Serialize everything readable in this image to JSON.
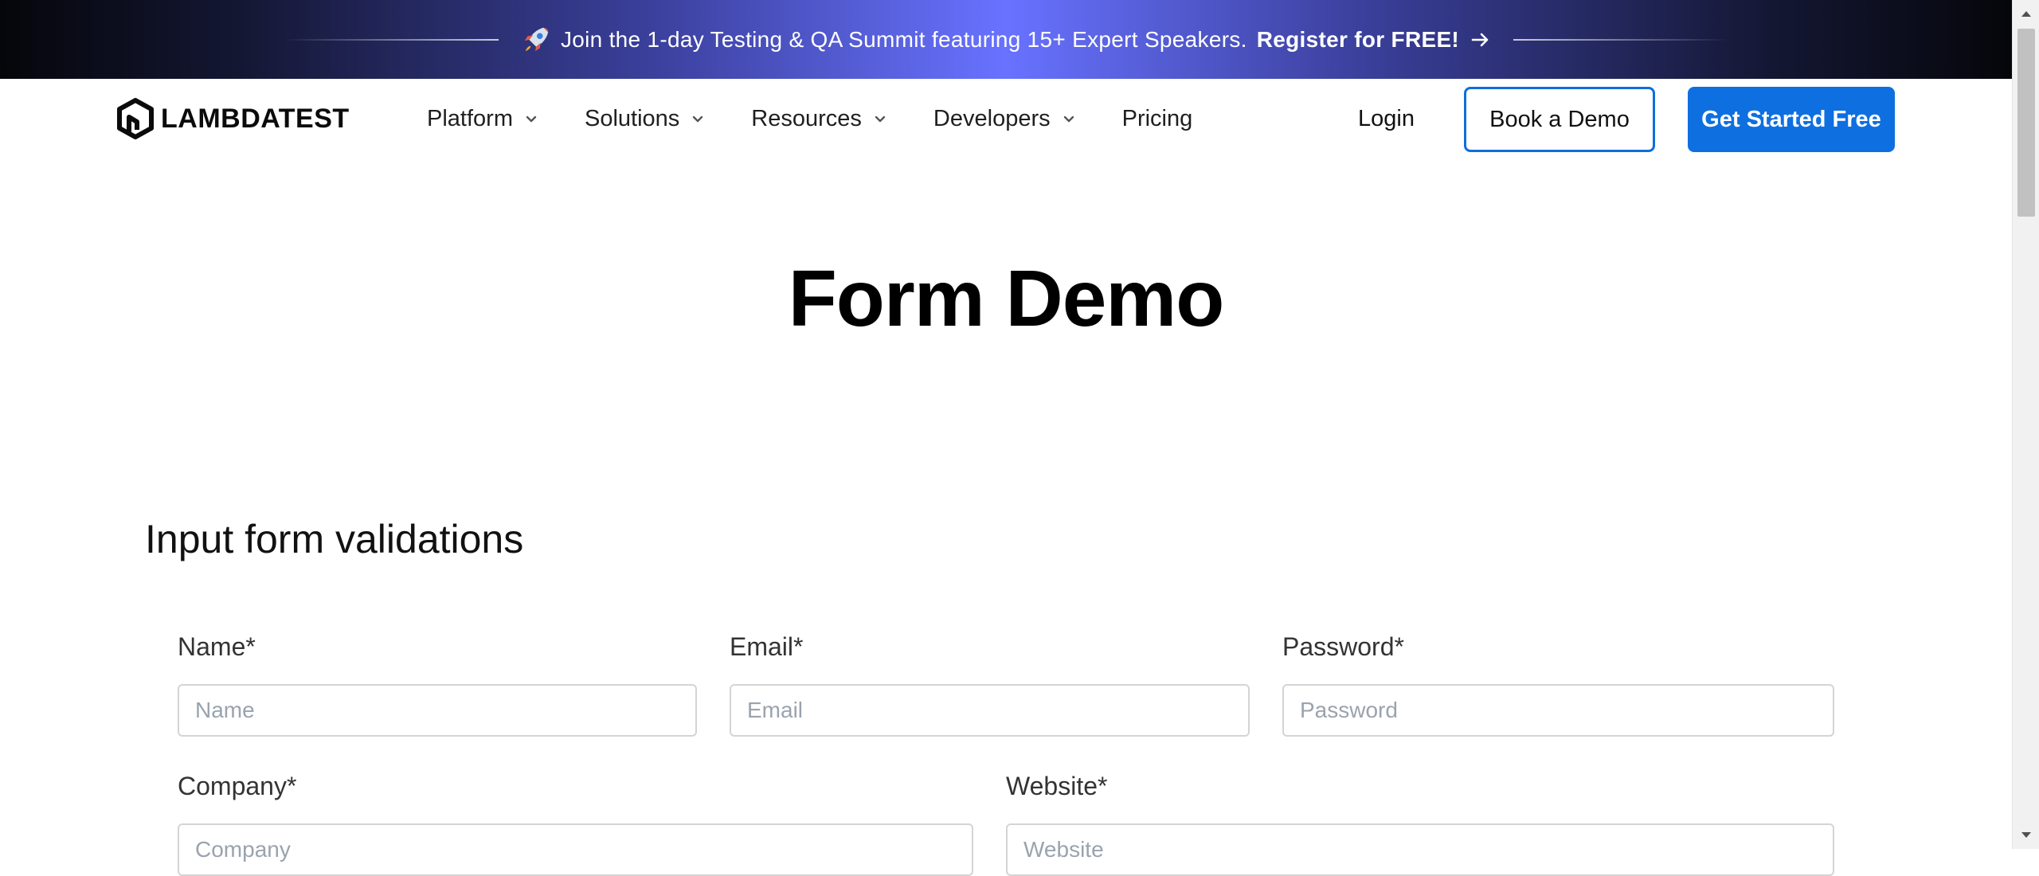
{
  "banner": {
    "text": "Join the 1-day Testing & QA Summit featuring 15+ Expert Speakers.",
    "cta": "Register for FREE!",
    "icons": [
      "rocket-icon",
      "arrow-right-icon"
    ]
  },
  "header": {
    "logo_text": "LAMBDATEST",
    "nav": [
      {
        "label": "Platform",
        "has_dropdown": true
      },
      {
        "label": "Solutions",
        "has_dropdown": true
      },
      {
        "label": "Resources",
        "has_dropdown": true
      },
      {
        "label": "Developers",
        "has_dropdown": true
      },
      {
        "label": "Pricing",
        "has_dropdown": false
      }
    ],
    "login": "Login",
    "book_demo": "Book a Demo",
    "get_started": "Get Started Free"
  },
  "page": {
    "title": "Form Demo"
  },
  "form": {
    "section_title": "Input form validations",
    "fields": {
      "name": {
        "label": "Name*",
        "placeholder": "Name",
        "value": ""
      },
      "email": {
        "label": "Email*",
        "placeholder": "Email",
        "value": ""
      },
      "password": {
        "label": "Password*",
        "placeholder": "Password",
        "value": ""
      },
      "company": {
        "label": "Company*",
        "placeholder": "Company",
        "value": ""
      },
      "website": {
        "label": "Website*",
        "placeholder": "Website",
        "value": ""
      }
    }
  },
  "colors": {
    "primary_blue": "#0e6fe0",
    "banner_center": "#6872ff",
    "banner_edge": "#05060a"
  }
}
